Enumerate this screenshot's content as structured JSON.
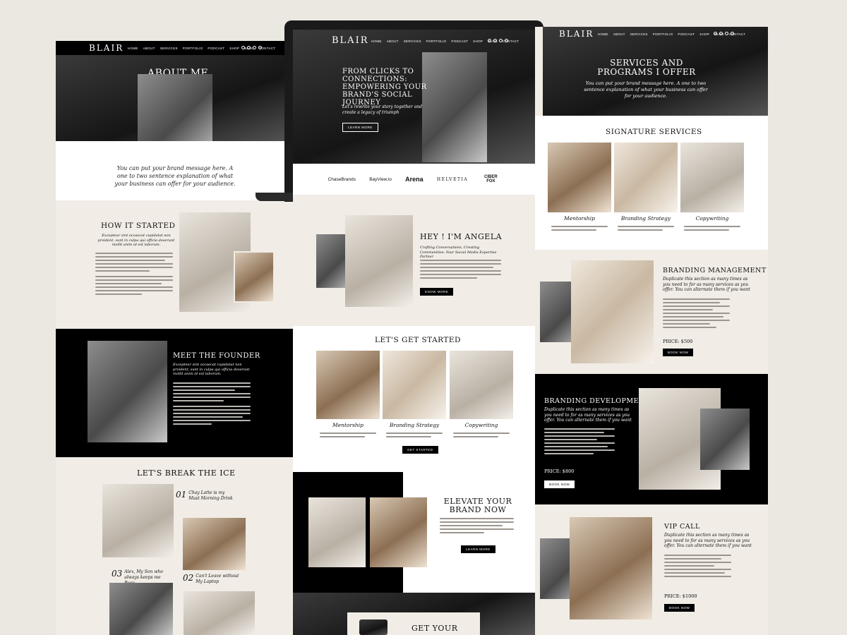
{
  "nav": {
    "logo": "BLAIR",
    "items": [
      "HOME",
      "ABOUT",
      "SERVICES",
      "PORTFOLIO",
      "PODCAST",
      "SHOP",
      "BLOG",
      "CONTACT"
    ]
  },
  "about": {
    "title": "ABOUT ME",
    "message": "You can put your brand message here. A one to two sentence explanation of what your business can offer for your audience."
  },
  "how_started": {
    "title": "HOW IT STARTED",
    "subtitle": "Excepteur sint occaecat cupidatat non proident, sunt in culpa qui officia deserunt mollit anim id est laborum."
  },
  "founder": {
    "title": "MEET THE FOUNDER",
    "subtitle": "Excepteur sint occaecat cupidatat non proident, sunt in culpa qui officia deserunt mollit anim id est laborum."
  },
  "break_ice": {
    "title": "LET'S BREAK THE ICE",
    "items": [
      {
        "num": "01",
        "text": "Chay Latte is my Must Morning Drink"
      },
      {
        "num": "02",
        "text": "Can't Leave without My Laptop"
      },
      {
        "num": "03",
        "text": "Alex, My Son who always keeps me Busy"
      }
    ]
  },
  "hero": {
    "headline": "FROM CLICKS TO CONNECTIONS: EMPOWERING YOUR BRAND'S SOCIAL JOURNEY",
    "subhead": "Let's rewrite your story together and create a legacy of triumph",
    "button": "LEARN MORE"
  },
  "brands": [
    "ChaseBrands",
    "BayView.io",
    "Arena",
    "HELVETIA",
    "CIBER FOX"
  ],
  "intro": {
    "title": "HEY ! I'M ANGELA",
    "subtitle": "Crafting Conversations, Creating Communities: Your Social Media Expertise Partner",
    "button": "KNOW MORE"
  },
  "get_started": {
    "title": "LET'S GET STARTED",
    "services": [
      "Mentorship",
      "Branding Strategy",
      "Copywriting"
    ],
    "button": "GET STARTED"
  },
  "elevate": {
    "title": "ELEVATE YOUR BRAND NOW",
    "button": "LEARN MORE"
  },
  "get_your": {
    "title": "GET YOUR"
  },
  "services_hero": {
    "title": "SERVICES AND PROGRAMS I OFFER",
    "message": "You can put your brand message here. A one to two sentence explanation of what your business can offer for your audience."
  },
  "signature": {
    "title": "SIGNATURE SERVICES",
    "services": [
      "Mentorship",
      "Branding Strategy",
      "Copywriting"
    ]
  },
  "packages": [
    {
      "title": "BRANDING MANAGEMENT",
      "subtitle": "Duplicate this section as many times as you need to for as many services as you offer. You can alternate them if you want",
      "price": "PRICE: $500",
      "button": "BOOK NOW"
    },
    {
      "title": "BRANDING DEVELOPMENT",
      "subtitle": "Duplicate this section as many times as you need to for as many services as you offer. You can alternate them if you want",
      "price": "PRICE: $800",
      "button": "BOOK NOW"
    },
    {
      "title": "VIP CALL",
      "subtitle": "Duplicate this section as many times as you need to for as many services as you offer. You can alternate them if you want",
      "price": "PRICE: $1000",
      "button": "BOOK NOW"
    }
  ],
  "colors": {
    "background": "#ebe7e1",
    "dark": "#000000",
    "cream": "#f1ece5",
    "white": "#ffffff"
  }
}
